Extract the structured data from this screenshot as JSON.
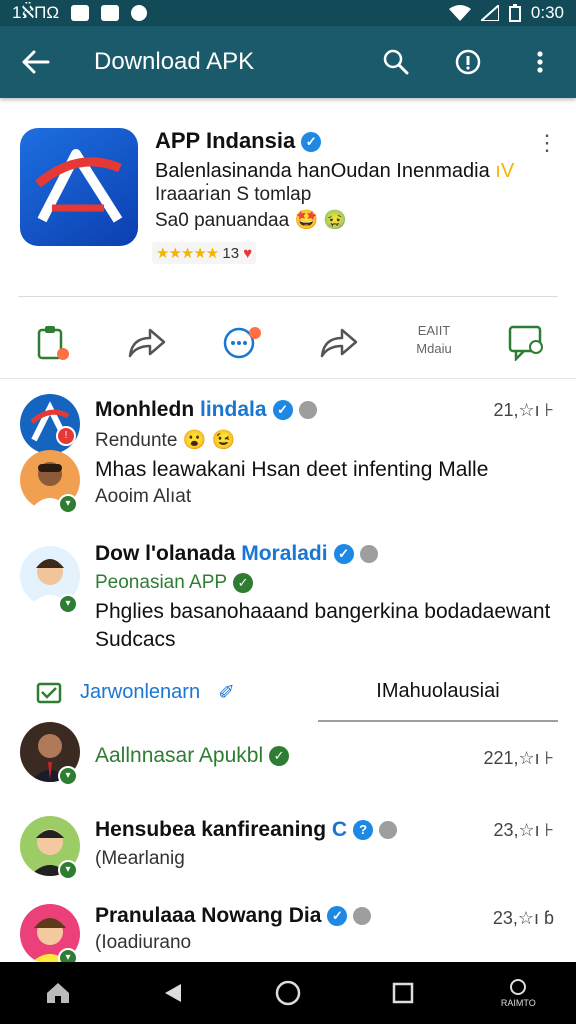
{
  "status_bar": {
    "left_text": "1ℵ̈ΠΩ",
    "time": "0:30"
  },
  "app_bar": {
    "title": "Download APK"
  },
  "app": {
    "name": "APP Indansia",
    "line1": "Balenlasinanda hanOudan Inenmadia",
    "line1_tag": "ıV",
    "line2": "Iraaarı̇an S tomlap",
    "line3": "Sa0 panuandaa",
    "rating": "13"
  },
  "actions": {
    "text_label_top": "EAIIT",
    "text_label_bottom": "Mdaiu"
  },
  "feed": [
    {
      "name": "Monhledn",
      "name_highlight": "lindala",
      "sub": "Rendunte",
      "time": "21,☆ı ⊦"
    },
    {
      "body": "Mhas leawakani Hsan deet infenting Malle",
      "sub": "Aooim Alıat"
    },
    {
      "name": "Dow l'olanada",
      "name_highlight": "Moraladi",
      "sub": "Peonasian APP",
      "body": "Phglies basanohaaand bangerkina bodadaewant",
      "body2": "Sudcacs"
    },
    {
      "name": "Aallnnasar Apukbl",
      "time": "221,☆ı ⊦"
    },
    {
      "name": "Hensubea kanfireaning",
      "name_tail": "C",
      "sub": "(Mearlanig",
      "time": "23,☆ı ⊦"
    },
    {
      "name": "Pranulaaa Nowang Dia",
      "sub": "(Ioadiurano",
      "time": "23,☆ı ɓ"
    }
  ],
  "tabs": {
    "left": "Jarwonlenarn",
    "right": "IMahuolausiai"
  },
  "nav": {
    "recent_label": "RAIMTO"
  },
  "colors": {
    "app_bar": "#1a5a6a",
    "status_bar": "#124a58",
    "accent_blue": "#1976d2",
    "accent_green": "#2e7d32"
  }
}
